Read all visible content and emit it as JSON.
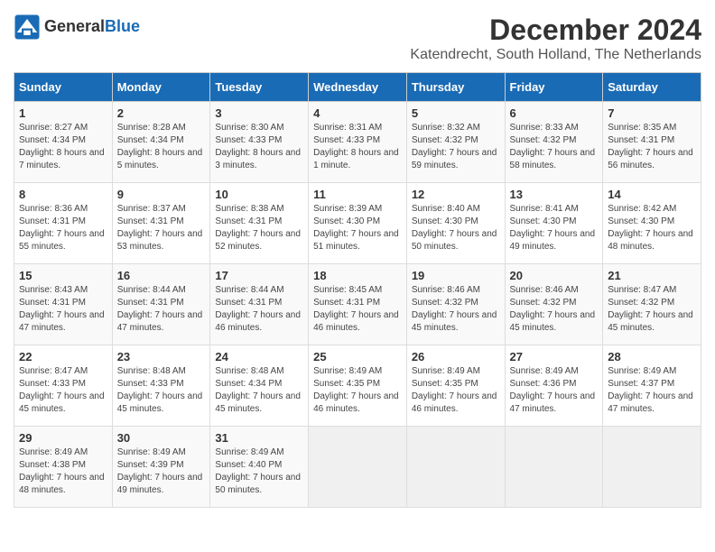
{
  "header": {
    "logo_general": "General",
    "logo_blue": "Blue",
    "month_title": "December 2024",
    "location": "Katendrecht, South Holland, The Netherlands"
  },
  "weekdays": [
    "Sunday",
    "Monday",
    "Tuesday",
    "Wednesday",
    "Thursday",
    "Friday",
    "Saturday"
  ],
  "weeks": [
    [
      {
        "day": "1",
        "sunrise": "8:27 AM",
        "sunset": "4:34 PM",
        "daylight": "8 hours and 7 minutes"
      },
      {
        "day": "2",
        "sunrise": "8:28 AM",
        "sunset": "4:34 PM",
        "daylight": "8 hours and 5 minutes"
      },
      {
        "day": "3",
        "sunrise": "8:30 AM",
        "sunset": "4:33 PM",
        "daylight": "8 hours and 3 minutes"
      },
      {
        "day": "4",
        "sunrise": "8:31 AM",
        "sunset": "4:33 PM",
        "daylight": "8 hours and 1 minute"
      },
      {
        "day": "5",
        "sunrise": "8:32 AM",
        "sunset": "4:32 PM",
        "daylight": "7 hours and 59 minutes"
      },
      {
        "day": "6",
        "sunrise": "8:33 AM",
        "sunset": "4:32 PM",
        "daylight": "7 hours and 58 minutes"
      },
      {
        "day": "7",
        "sunrise": "8:35 AM",
        "sunset": "4:31 PM",
        "daylight": "7 hours and 56 minutes"
      }
    ],
    [
      {
        "day": "8",
        "sunrise": "8:36 AM",
        "sunset": "4:31 PM",
        "daylight": "7 hours and 55 minutes"
      },
      {
        "day": "9",
        "sunrise": "8:37 AM",
        "sunset": "4:31 PM",
        "daylight": "7 hours and 53 minutes"
      },
      {
        "day": "10",
        "sunrise": "8:38 AM",
        "sunset": "4:31 PM",
        "daylight": "7 hours and 52 minutes"
      },
      {
        "day": "11",
        "sunrise": "8:39 AM",
        "sunset": "4:30 PM",
        "daylight": "7 hours and 51 minutes"
      },
      {
        "day": "12",
        "sunrise": "8:40 AM",
        "sunset": "4:30 PM",
        "daylight": "7 hours and 50 minutes"
      },
      {
        "day": "13",
        "sunrise": "8:41 AM",
        "sunset": "4:30 PM",
        "daylight": "7 hours and 49 minutes"
      },
      {
        "day": "14",
        "sunrise": "8:42 AM",
        "sunset": "4:30 PM",
        "daylight": "7 hours and 48 minutes"
      }
    ],
    [
      {
        "day": "15",
        "sunrise": "8:43 AM",
        "sunset": "4:31 PM",
        "daylight": "7 hours and 47 minutes"
      },
      {
        "day": "16",
        "sunrise": "8:44 AM",
        "sunset": "4:31 PM",
        "daylight": "7 hours and 47 minutes"
      },
      {
        "day": "17",
        "sunrise": "8:44 AM",
        "sunset": "4:31 PM",
        "daylight": "7 hours and 46 minutes"
      },
      {
        "day": "18",
        "sunrise": "8:45 AM",
        "sunset": "4:31 PM",
        "daylight": "7 hours and 46 minutes"
      },
      {
        "day": "19",
        "sunrise": "8:46 AM",
        "sunset": "4:32 PM",
        "daylight": "7 hours and 45 minutes"
      },
      {
        "day": "20",
        "sunrise": "8:46 AM",
        "sunset": "4:32 PM",
        "daylight": "7 hours and 45 minutes"
      },
      {
        "day": "21",
        "sunrise": "8:47 AM",
        "sunset": "4:32 PM",
        "daylight": "7 hours and 45 minutes"
      }
    ],
    [
      {
        "day": "22",
        "sunrise": "8:47 AM",
        "sunset": "4:33 PM",
        "daylight": "7 hours and 45 minutes"
      },
      {
        "day": "23",
        "sunrise": "8:48 AM",
        "sunset": "4:33 PM",
        "daylight": "7 hours and 45 minutes"
      },
      {
        "day": "24",
        "sunrise": "8:48 AM",
        "sunset": "4:34 PM",
        "daylight": "7 hours and 45 minutes"
      },
      {
        "day": "25",
        "sunrise": "8:49 AM",
        "sunset": "4:35 PM",
        "daylight": "7 hours and 46 minutes"
      },
      {
        "day": "26",
        "sunrise": "8:49 AM",
        "sunset": "4:35 PM",
        "daylight": "7 hours and 46 minutes"
      },
      {
        "day": "27",
        "sunrise": "8:49 AM",
        "sunset": "4:36 PM",
        "daylight": "7 hours and 47 minutes"
      },
      {
        "day": "28",
        "sunrise": "8:49 AM",
        "sunset": "4:37 PM",
        "daylight": "7 hours and 47 minutes"
      }
    ],
    [
      {
        "day": "29",
        "sunrise": "8:49 AM",
        "sunset": "4:38 PM",
        "daylight": "7 hours and 48 minutes"
      },
      {
        "day": "30",
        "sunrise": "8:49 AM",
        "sunset": "4:39 PM",
        "daylight": "7 hours and 49 minutes"
      },
      {
        "day": "31",
        "sunrise": "8:49 AM",
        "sunset": "4:40 PM",
        "daylight": "7 hours and 50 minutes"
      },
      null,
      null,
      null,
      null
    ]
  ]
}
